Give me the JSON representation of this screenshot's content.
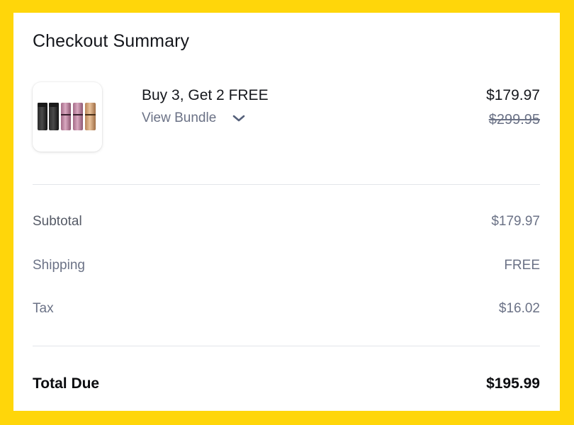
{
  "summary": {
    "title": "Checkout Summary"
  },
  "product": {
    "name": "Buy 3, Get 2 FREE",
    "bundle_toggle_label": "View Bundle",
    "price": "$179.97",
    "original_price": "$299.95",
    "image_icon": "product-bundle-image",
    "toggle_icon": "chevron-down-icon"
  },
  "lines": [
    {
      "label": "Subtotal",
      "value": "$179.97"
    },
    {
      "label": "Shipping",
      "value": "FREE"
    },
    {
      "label": "Tax",
      "value": "$16.02"
    }
  ],
  "total": {
    "label": "Total Due",
    "value": "$195.99"
  },
  "colors": {
    "page_background": "#FFD60A",
    "card_background": "#FFFFFF",
    "primary_text": "#15171C",
    "secondary_text": "#6B7286",
    "divider": "#E3E5EA"
  }
}
